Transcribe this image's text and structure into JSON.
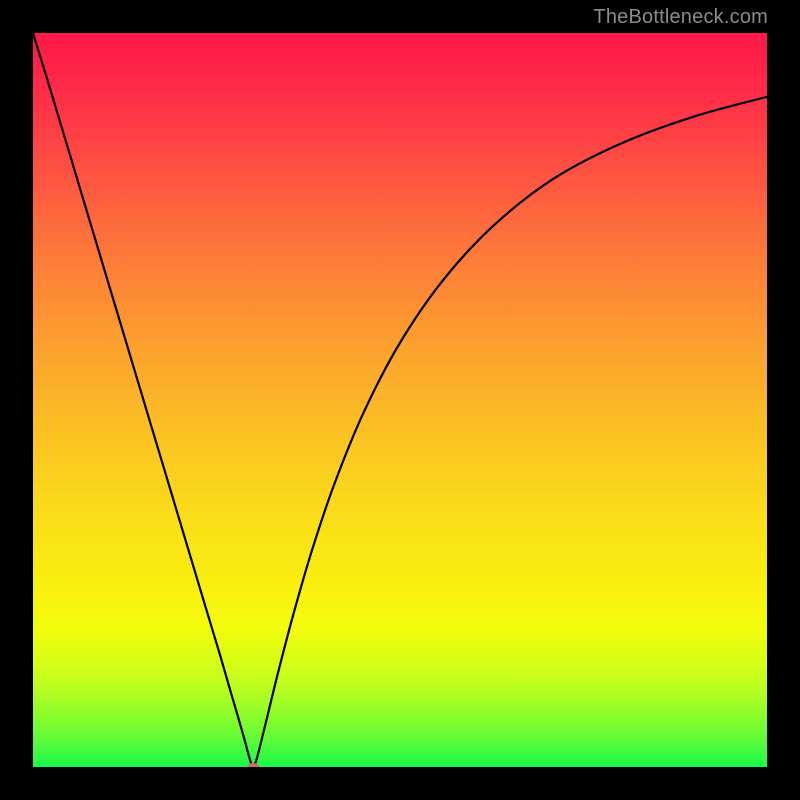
{
  "watermark": {
    "text": "TheBottleneck.com"
  },
  "chart_data": {
    "type": "line",
    "title": "",
    "xlabel": "",
    "ylabel": "",
    "xlim": [
      0,
      100
    ],
    "ylim": [
      0,
      100
    ],
    "series": [
      {
        "name": "bottleneck-curve",
        "x": [
          0,
          2,
          5,
          8,
          11,
          14,
          17,
          20,
          23,
          25.5,
          27,
          28,
          28.8,
          29.3,
          29.6,
          29.8,
          30,
          30.2,
          30.5,
          31,
          32,
          33.5,
          35.5,
          38,
          41,
          45,
          50,
          56,
          63,
          71,
          80,
          90,
          100
        ],
        "y": [
          100,
          93.5,
          83.5,
          73.5,
          63.5,
          53.5,
          43.5,
          33.5,
          23.5,
          15.2,
          10,
          6.6,
          3.8,
          1.9,
          0.9,
          0.3,
          0,
          0.3,
          1.2,
          3.1,
          7.2,
          13.3,
          20.9,
          29.5,
          38.4,
          48.2,
          57.8,
          66.5,
          74,
          80.2,
          84.9,
          88.6,
          91.3
        ]
      }
    ],
    "marker": {
      "x": 30,
      "y": 0,
      "color": "#d36969",
      "rx": 6,
      "ry": 4
    }
  }
}
